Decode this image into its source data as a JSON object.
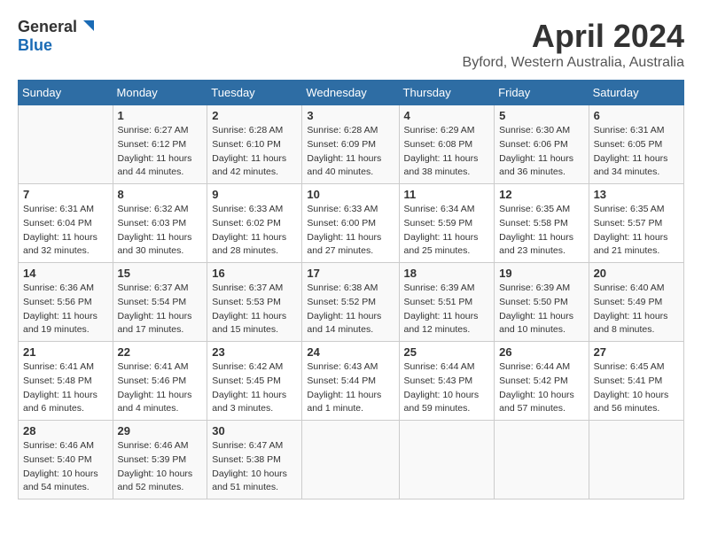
{
  "logo": {
    "general": "General",
    "blue": "Blue"
  },
  "title": "April 2024",
  "subtitle": "Byford, Western Australia, Australia",
  "days_of_week": [
    "Sunday",
    "Monday",
    "Tuesday",
    "Wednesday",
    "Thursday",
    "Friday",
    "Saturday"
  ],
  "weeks": [
    [
      {
        "day": "",
        "sunrise": "",
        "sunset": "",
        "daylight": ""
      },
      {
        "day": "1",
        "sunrise": "Sunrise: 6:27 AM",
        "sunset": "Sunset: 6:12 PM",
        "daylight": "Daylight: 11 hours and 44 minutes."
      },
      {
        "day": "2",
        "sunrise": "Sunrise: 6:28 AM",
        "sunset": "Sunset: 6:10 PM",
        "daylight": "Daylight: 11 hours and 42 minutes."
      },
      {
        "day": "3",
        "sunrise": "Sunrise: 6:28 AM",
        "sunset": "Sunset: 6:09 PM",
        "daylight": "Daylight: 11 hours and 40 minutes."
      },
      {
        "day": "4",
        "sunrise": "Sunrise: 6:29 AM",
        "sunset": "Sunset: 6:08 PM",
        "daylight": "Daylight: 11 hours and 38 minutes."
      },
      {
        "day": "5",
        "sunrise": "Sunrise: 6:30 AM",
        "sunset": "Sunset: 6:06 PM",
        "daylight": "Daylight: 11 hours and 36 minutes."
      },
      {
        "day": "6",
        "sunrise": "Sunrise: 6:31 AM",
        "sunset": "Sunset: 6:05 PM",
        "daylight": "Daylight: 11 hours and 34 minutes."
      }
    ],
    [
      {
        "day": "7",
        "sunrise": "Sunrise: 6:31 AM",
        "sunset": "Sunset: 6:04 PM",
        "daylight": "Daylight: 11 hours and 32 minutes."
      },
      {
        "day": "8",
        "sunrise": "Sunrise: 6:32 AM",
        "sunset": "Sunset: 6:03 PM",
        "daylight": "Daylight: 11 hours and 30 minutes."
      },
      {
        "day": "9",
        "sunrise": "Sunrise: 6:33 AM",
        "sunset": "Sunset: 6:02 PM",
        "daylight": "Daylight: 11 hours and 28 minutes."
      },
      {
        "day": "10",
        "sunrise": "Sunrise: 6:33 AM",
        "sunset": "Sunset: 6:00 PM",
        "daylight": "Daylight: 11 hours and 27 minutes."
      },
      {
        "day": "11",
        "sunrise": "Sunrise: 6:34 AM",
        "sunset": "Sunset: 5:59 PM",
        "daylight": "Daylight: 11 hours and 25 minutes."
      },
      {
        "day": "12",
        "sunrise": "Sunrise: 6:35 AM",
        "sunset": "Sunset: 5:58 PM",
        "daylight": "Daylight: 11 hours and 23 minutes."
      },
      {
        "day": "13",
        "sunrise": "Sunrise: 6:35 AM",
        "sunset": "Sunset: 5:57 PM",
        "daylight": "Daylight: 11 hours and 21 minutes."
      }
    ],
    [
      {
        "day": "14",
        "sunrise": "Sunrise: 6:36 AM",
        "sunset": "Sunset: 5:56 PM",
        "daylight": "Daylight: 11 hours and 19 minutes."
      },
      {
        "day": "15",
        "sunrise": "Sunrise: 6:37 AM",
        "sunset": "Sunset: 5:54 PM",
        "daylight": "Daylight: 11 hours and 17 minutes."
      },
      {
        "day": "16",
        "sunrise": "Sunrise: 6:37 AM",
        "sunset": "Sunset: 5:53 PM",
        "daylight": "Daylight: 11 hours and 15 minutes."
      },
      {
        "day": "17",
        "sunrise": "Sunrise: 6:38 AM",
        "sunset": "Sunset: 5:52 PM",
        "daylight": "Daylight: 11 hours and 14 minutes."
      },
      {
        "day": "18",
        "sunrise": "Sunrise: 6:39 AM",
        "sunset": "Sunset: 5:51 PM",
        "daylight": "Daylight: 11 hours and 12 minutes."
      },
      {
        "day": "19",
        "sunrise": "Sunrise: 6:39 AM",
        "sunset": "Sunset: 5:50 PM",
        "daylight": "Daylight: 11 hours and 10 minutes."
      },
      {
        "day": "20",
        "sunrise": "Sunrise: 6:40 AM",
        "sunset": "Sunset: 5:49 PM",
        "daylight": "Daylight: 11 hours and 8 minutes."
      }
    ],
    [
      {
        "day": "21",
        "sunrise": "Sunrise: 6:41 AM",
        "sunset": "Sunset: 5:48 PM",
        "daylight": "Daylight: 11 hours and 6 minutes."
      },
      {
        "day": "22",
        "sunrise": "Sunrise: 6:41 AM",
        "sunset": "Sunset: 5:46 PM",
        "daylight": "Daylight: 11 hours and 4 minutes."
      },
      {
        "day": "23",
        "sunrise": "Sunrise: 6:42 AM",
        "sunset": "Sunset: 5:45 PM",
        "daylight": "Daylight: 11 hours and 3 minutes."
      },
      {
        "day": "24",
        "sunrise": "Sunrise: 6:43 AM",
        "sunset": "Sunset: 5:44 PM",
        "daylight": "Daylight: 11 hours and 1 minute."
      },
      {
        "day": "25",
        "sunrise": "Sunrise: 6:44 AM",
        "sunset": "Sunset: 5:43 PM",
        "daylight": "Daylight: 10 hours and 59 minutes."
      },
      {
        "day": "26",
        "sunrise": "Sunrise: 6:44 AM",
        "sunset": "Sunset: 5:42 PM",
        "daylight": "Daylight: 10 hours and 57 minutes."
      },
      {
        "day": "27",
        "sunrise": "Sunrise: 6:45 AM",
        "sunset": "Sunset: 5:41 PM",
        "daylight": "Daylight: 10 hours and 56 minutes."
      }
    ],
    [
      {
        "day": "28",
        "sunrise": "Sunrise: 6:46 AM",
        "sunset": "Sunset: 5:40 PM",
        "daylight": "Daylight: 10 hours and 54 minutes."
      },
      {
        "day": "29",
        "sunrise": "Sunrise: 6:46 AM",
        "sunset": "Sunset: 5:39 PM",
        "daylight": "Daylight: 10 hours and 52 minutes."
      },
      {
        "day": "30",
        "sunrise": "Sunrise: 6:47 AM",
        "sunset": "Sunset: 5:38 PM",
        "daylight": "Daylight: 10 hours and 51 minutes."
      },
      {
        "day": "",
        "sunrise": "",
        "sunset": "",
        "daylight": ""
      },
      {
        "day": "",
        "sunrise": "",
        "sunset": "",
        "daylight": ""
      },
      {
        "day": "",
        "sunrise": "",
        "sunset": "",
        "daylight": ""
      },
      {
        "day": "",
        "sunrise": "",
        "sunset": "",
        "daylight": ""
      }
    ]
  ]
}
